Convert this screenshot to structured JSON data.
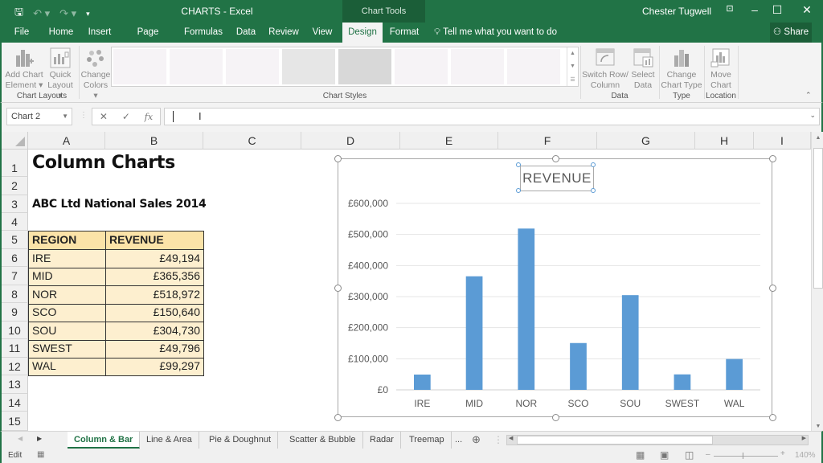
{
  "window": {
    "title": "CHARTS - Excel",
    "context_tab_group": "Chart Tools",
    "user": "Chester Tugwell",
    "tell_me": "Tell me what you want to do",
    "share": "Share"
  },
  "ribbon_tabs": [
    {
      "label": "File"
    },
    {
      "label": "Home"
    },
    {
      "label": "Insert"
    },
    {
      "label": "Page Layout"
    },
    {
      "label": "Formulas"
    },
    {
      "label": "Data"
    },
    {
      "label": "Review"
    },
    {
      "label": "View"
    },
    {
      "label": "Design",
      "active": true
    },
    {
      "label": "Format"
    }
  ],
  "ribbon": {
    "add_chart_element": [
      "Add Chart",
      "Element"
    ],
    "quick_layout": [
      "Quick",
      "Layout"
    ],
    "change_colors": [
      "Change",
      "Colors"
    ],
    "switch_row_column": [
      "Switch Row/",
      "Column"
    ],
    "select_data": [
      "Select",
      "Data"
    ],
    "change_chart_type": [
      "Change",
      "Chart Type"
    ],
    "move_chart": [
      "Move",
      "Chart"
    ],
    "groups": {
      "chart_layouts": "Chart Layouts",
      "chart_styles": "Chart Styles",
      "data": "Data",
      "type": "Type",
      "location": "Location"
    },
    "style_count_visible": 8
  },
  "formula_bar": {
    "name_box": "Chart 2",
    "cancel": "✕",
    "enter": "✓",
    "fx": "fx",
    "value": ""
  },
  "columns": [
    "A",
    "B",
    "C",
    "D",
    "E",
    "F",
    "G",
    "H",
    "I"
  ],
  "rows": [
    "1",
    "2",
    "3",
    "4",
    "5",
    "6",
    "7",
    "8",
    "9",
    "10",
    "11",
    "12",
    "13",
    "14",
    "15"
  ],
  "sheet": {
    "title": "Column  Charts",
    "subtitle": "ABC Ltd National Sales 2014",
    "headers": [
      "REGION",
      "REVENUE"
    ],
    "data": [
      [
        "IRE",
        "£49,194"
      ],
      [
        "MID",
        "£365,356"
      ],
      [
        "NOR",
        "£518,972"
      ],
      [
        "SCO",
        "£150,640"
      ],
      [
        "SOU",
        "£304,730"
      ],
      [
        "SWEST",
        "£49,796"
      ],
      [
        "WAL",
        "£99,297"
      ]
    ]
  },
  "chart_data": {
    "type": "bar",
    "title": "REVENUE",
    "categories": [
      "IRE",
      "MID",
      "NOR",
      "SCO",
      "SOU",
      "SWEST",
      "WAL"
    ],
    "values": [
      49194,
      365356,
      518972,
      150640,
      304730,
      49796,
      99297
    ],
    "ylim": [
      0,
      600000
    ],
    "yticks": [
      0,
      100000,
      200000,
      300000,
      400000,
      500000,
      600000
    ],
    "ytick_labels": [
      "£0",
      "£100,000",
      "£200,000",
      "£300,000",
      "£400,000",
      "£500,000",
      "£600,000"
    ],
    "xlabel": "",
    "ylabel": "",
    "grid": true,
    "legend": "none",
    "bar_color": "#5b9bd5"
  },
  "sheet_tabs": [
    {
      "label": "Column & Bar",
      "active": true
    },
    {
      "label": "Line & Area"
    },
    {
      "label": "Pie & Doughnut"
    },
    {
      "label": "Scatter & Bubble"
    },
    {
      "label": "Radar"
    },
    {
      "label": "Treemap"
    },
    {
      "label": "..."
    }
  ],
  "status": {
    "mode": "Edit",
    "zoom": "140%"
  },
  "colors": {
    "brand": "#217346",
    "table_fill": "#fdefcf",
    "header_fill": "#fbe3a8"
  }
}
